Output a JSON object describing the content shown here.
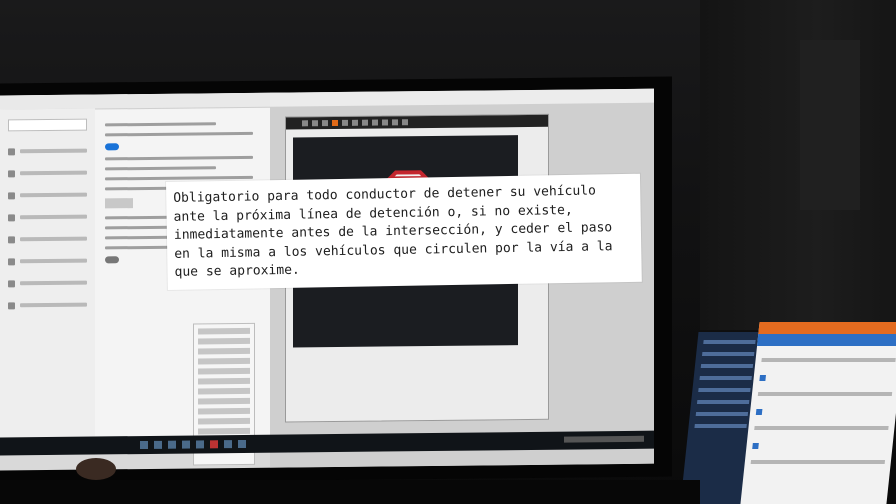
{
  "caption": {
    "lines": [
      "Obligatorio para todo conductor de detener su vehículo",
      "ante la próxima línea de detención o, si no existe,",
      "inmediatamente antes de la intersección, y ceder el paso",
      "en la misma a los vehículos que circulen por la vía a la",
      "que se aproxime."
    ]
  },
  "colors": {
    "stop_sign": "#c4262e",
    "accent_blue": "#1a73d8",
    "laptop_orange": "#e46b1f"
  },
  "icons": [
    "stop-sign-icon"
  ]
}
